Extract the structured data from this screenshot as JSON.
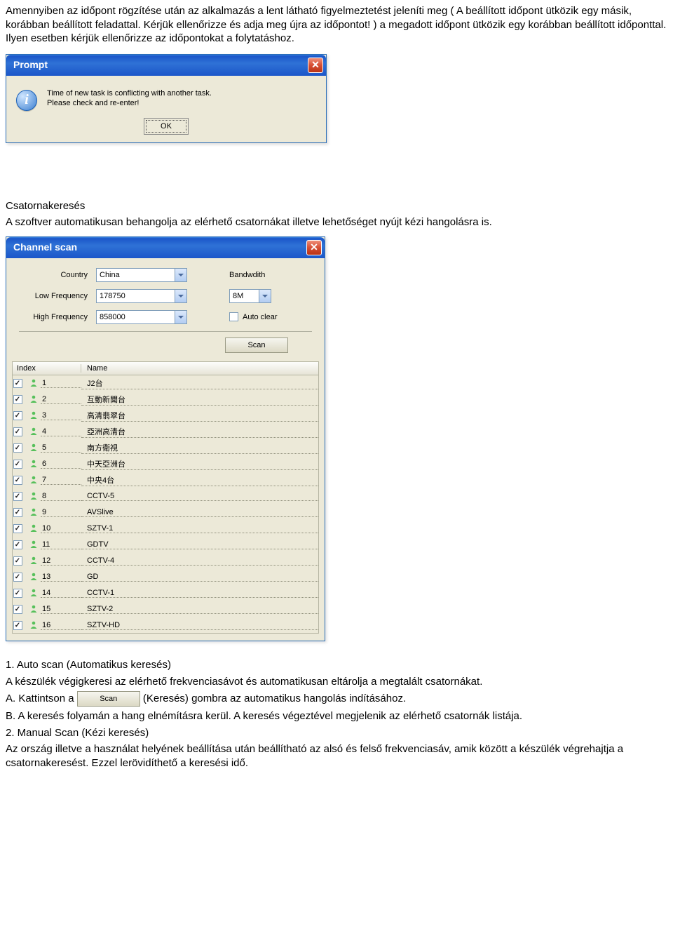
{
  "intro_para": "Amennyiben az időpont rögzítése után az alkalmazás a lent látható figyelmeztetést jeleníti meg ( A beállított időpont ütközik egy másik, korábban beállított feladattal. Kérjük ellenőrizze és adja meg újra az időpontot! ) a megadott időpont ütközik egy korábban beállított időponttal. Ilyen esetben kérjük ellenőrizze az időpontokat a folytatáshoz.",
  "prompt": {
    "title": "Prompt",
    "line1": "Time of new task is conflicting with another task.",
    "line2": "Please check and re-enter!",
    "ok": "OK"
  },
  "section": {
    "heading": "Csatornakeresés",
    "desc": "A szoftver automatikusan behangolja az elérhető csatornákat illetve lehetőséget nyújt kézi hangolásra is."
  },
  "scan": {
    "title": "Channel scan",
    "labels": {
      "country": "Country",
      "lowfreq": "Low Frequency",
      "highfreq": "High Frequency",
      "bandwidth": "Bandwdith",
      "autoclear": "Auto clear"
    },
    "values": {
      "country": "China",
      "lowfreq": "178750",
      "highfreq": "858000",
      "bandwidth": "8M"
    },
    "scan_btn": "Scan",
    "list_headers": {
      "index": "Index",
      "name": "Name"
    },
    "channels": [
      {
        "idx": "1",
        "name": "J2台"
      },
      {
        "idx": "2",
        "name": "互動新聞台"
      },
      {
        "idx": "3",
        "name": "高清翡翠台"
      },
      {
        "idx": "4",
        "name": "亞洲高清台"
      },
      {
        "idx": "5",
        "name": "南方衛視"
      },
      {
        "idx": "6",
        "name": "中天亞洲台"
      },
      {
        "idx": "7",
        "name": "中央4台"
      },
      {
        "idx": "8",
        "name": "CCTV-5"
      },
      {
        "idx": "9",
        "name": "AVSlive"
      },
      {
        "idx": "10",
        "name": "SZTV-1"
      },
      {
        "idx": "11",
        "name": "GDTV"
      },
      {
        "idx": "12",
        "name": "CCTV-4"
      },
      {
        "idx": "13",
        "name": "GD"
      },
      {
        "idx": "14",
        "name": "CCTV-1"
      },
      {
        "idx": "15",
        "name": "SZTV-2"
      },
      {
        "idx": "16",
        "name": "SZTV-HD"
      }
    ]
  },
  "instr": {
    "h1": "1. Auto scan (Automatikus keresés)",
    "l1": "A készülék végigkeresi az elérhető frekvenciasávot és automatikusan eltárolja a megtalált csatornákat.",
    "lA_pre": "A. Kattintson a ",
    "lA_btn": "Scan",
    "lA_post": " (Keresés) gombra az automatikus hangolás indításához.",
    "lB": "B. A keresés folyamán a hang elnémításra kerül. A keresés végeztével megjelenik az elérhető csatornák listája.",
    "h2": "2. Manual Scan (Kézi keresés)",
    "l2": "Az ország illetve a használat helyének beállítása után beállítható az alsó és felső frekvenciasáv, amik között a készülék végrehajtja a csatornakeresést. Ezzel lerövidíthető a keresési idő."
  }
}
